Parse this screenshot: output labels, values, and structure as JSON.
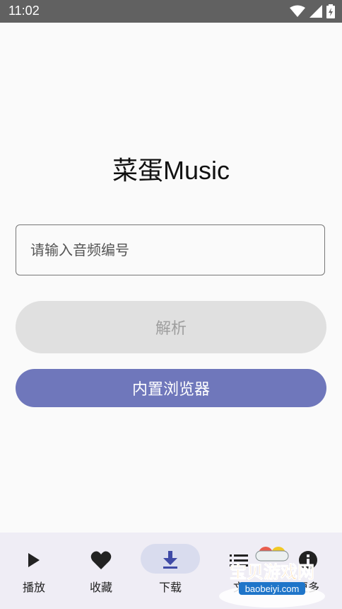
{
  "status_bar": {
    "time": "11:02"
  },
  "app": {
    "title": "菜蛋Music"
  },
  "search": {
    "placeholder": "请输入音频编号",
    "value": ""
  },
  "buttons": {
    "parse": "解析",
    "browser": "内置浏览器"
  },
  "bottom_nav": {
    "items": [
      {
        "label": "播放",
        "icon": "play-icon",
        "active": false
      },
      {
        "label": "收藏",
        "icon": "heart-icon",
        "active": false
      },
      {
        "label": "下载",
        "icon": "download-icon",
        "active": true
      },
      {
        "label": "文",
        "icon": "list-icon",
        "active": false
      },
      {
        "label": "更多",
        "icon": "info-icon",
        "active": false
      }
    ]
  },
  "watermark": {
    "text": "宝贝游戏网",
    "domain": "baobeiyi.com"
  },
  "colors": {
    "accent": "#6f77bb",
    "disabled": "#e0e0e0",
    "status_bar": "#616161"
  }
}
